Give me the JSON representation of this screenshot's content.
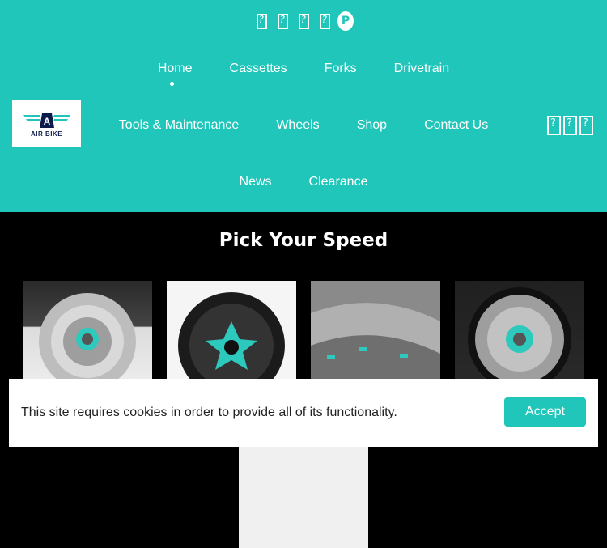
{
  "social_icons": [
    "icon-1",
    "icon-2",
    "icon-3",
    "icon-4",
    "pinterest-icon"
  ],
  "logo": {
    "text": "AIR BIKE"
  },
  "nav": {
    "row1": [
      "Home",
      "Cassettes",
      "Forks",
      "Drivetrain"
    ],
    "row2": [
      "Tools & Maintenance",
      "Wheels",
      "Shop",
      "Contact Us"
    ],
    "row3": [
      "News",
      "Clearance"
    ]
  },
  "header_tools": [
    "search-icon",
    "account-icon",
    "cart-icon"
  ],
  "section": {
    "title": "Pick Your Speed"
  },
  "cookie": {
    "message": "This site requires cookies in order to provide all of its functionality.",
    "accept_label": "Accept"
  },
  "colors": {
    "brand": "#1fc6b9",
    "background": "#000000"
  }
}
